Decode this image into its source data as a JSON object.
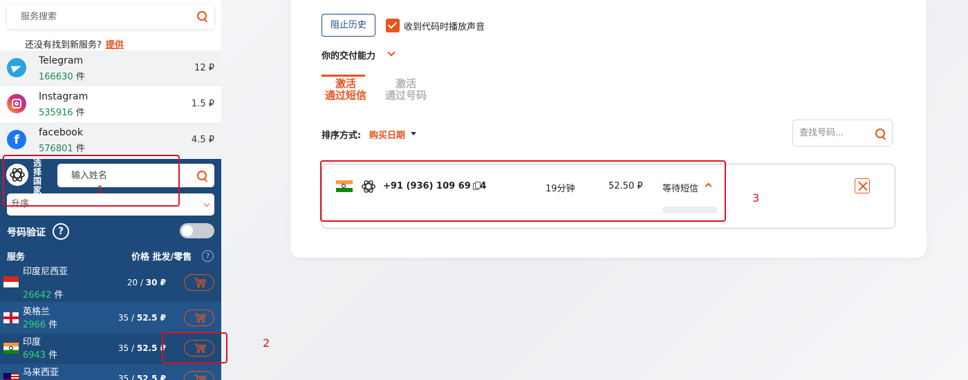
{
  "sidebar": {
    "search": {
      "placeholder": "服务搜索"
    },
    "not_found": {
      "text": "还没有找到新服务?",
      "link": "提供"
    },
    "services": [
      {
        "name": "Telegram",
        "count": "166630",
        "unit": "件",
        "price": "12 ₽",
        "icon": "telegram-icon"
      },
      {
        "name": "Instagram",
        "count": "535916",
        "unit": "件",
        "price": "1.5 ₽",
        "icon": "instagram-icon"
      },
      {
        "name": "facebook",
        "count": "576801",
        "unit": "件",
        "price": "4.5 ₽",
        "icon": "facebook-icon"
      }
    ],
    "country_filter": {
      "label": "选择国家",
      "name_placeholder": "输入姓名",
      "sort_value": "升序"
    },
    "number_verification": {
      "label": "号码验证",
      "help": "?"
    },
    "table_header": {
      "service": "服务",
      "price": "价格 批发/零售",
      "help": "?"
    },
    "countries": [
      {
        "name": "印度尼西亚",
        "count": "26642",
        "unit": "件",
        "price_wholesale": "20",
        "price_retail": "30 ₽",
        "flag": "indonesia-flag"
      },
      {
        "name": "英格兰",
        "count": "2966",
        "unit": "件",
        "price_wholesale": "35",
        "price_retail": "52.5 ₽",
        "flag": "england-flag"
      },
      {
        "name": "印度",
        "count": "6943",
        "unit": "件",
        "price_wholesale": "35",
        "price_retail": "52.5 ₽",
        "flag": "india-flag"
      },
      {
        "name": "马来西亚",
        "count": "",
        "unit": "",
        "price_wholesale": "35",
        "price_retail": "52.5 ₽",
        "flag": "malaysia-flag"
      }
    ]
  },
  "main": {
    "block_history": "阻止历史",
    "sound_checkbox": {
      "label": "收到代码时播放声音",
      "checked": true
    },
    "delivery_label": "你的交付能力",
    "tabs": [
      {
        "line1": "激活",
        "line2": "通过短信",
        "active": true
      },
      {
        "line1": "激活",
        "line2": "通过号码",
        "active": false
      }
    ],
    "sort": {
      "label": "排序方式:",
      "value": "购买日期"
    },
    "number_search": {
      "placeholder": "查找号码..."
    },
    "order": {
      "flag": "india-flag",
      "service_icon": "openai-icon",
      "phone": "+91 (936) 109 69 64",
      "time": "19分钟",
      "price": "52.50 ₽",
      "status": "等待短信"
    }
  },
  "annotations": [
    "1",
    "2",
    "3"
  ],
  "colors": {
    "accent": "#e8531e",
    "sidebar_dark": "#1d4a7a",
    "green": "#1b8a4b",
    "annotation": "#e0111b"
  }
}
